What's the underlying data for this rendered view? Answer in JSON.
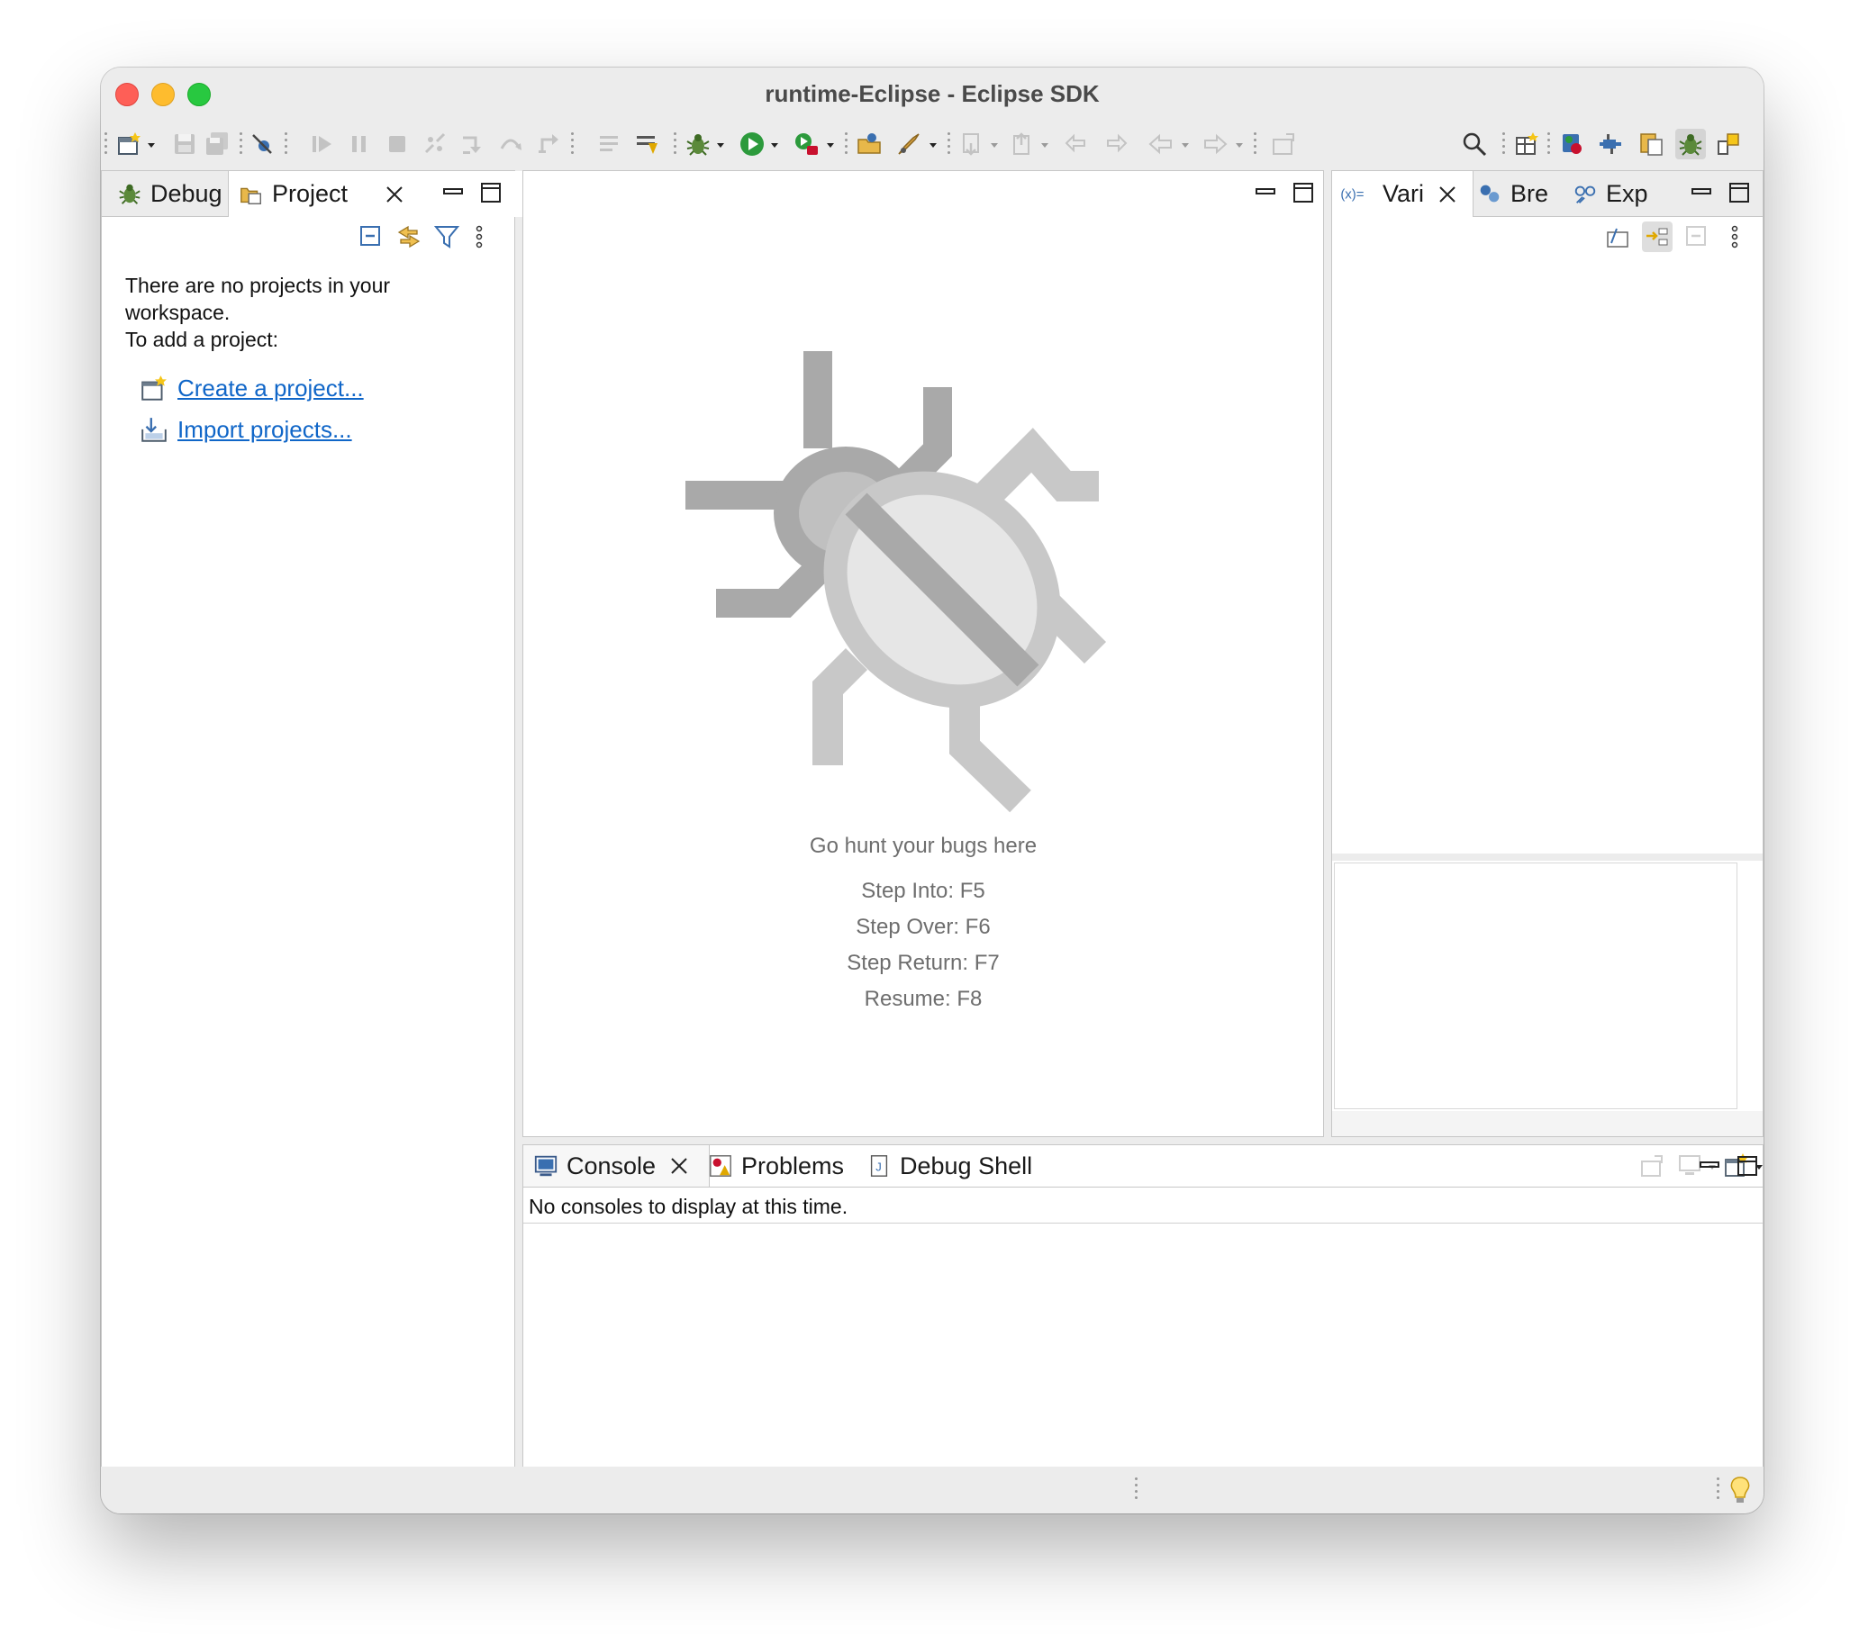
{
  "window": {
    "title": "runtime-Eclipse - Eclipse SDK"
  },
  "toolbar": {
    "icons": [
      "new-wizard-icon",
      "save-icon",
      "save-all-icon",
      "skip-breakpoints-icon",
      "resume-icon",
      "suspend-icon",
      "terminate-icon",
      "disconnect-icon",
      "step-into-icon",
      "step-over-icon",
      "step-return-icon",
      "drop-to-frame-icon",
      "use-step-filters-icon",
      "debug-icon",
      "run-icon",
      "external-tools-icon",
      "open-type-icon",
      "open-task-icon",
      "next-annotation-icon",
      "previous-annotation-icon",
      "last-edit-icon",
      "back-icon",
      "forward-icon",
      "pin-editor-icon",
      "search-icon",
      "open-perspective-icon",
      "java-perspective-icon",
      "plugin-perspective-icon",
      "resource-perspective-icon",
      "debug-perspective-icon",
      "git-perspective-icon"
    ]
  },
  "left_panel": {
    "tabs": [
      {
        "label": "Debug",
        "icon": "bug-icon"
      },
      {
        "label": "Project",
        "icon": "project-explorer-icon"
      }
    ],
    "empty_line1": "There are no projects in your workspace.",
    "empty_line2": "To add a project:",
    "create_link": "Create a project...",
    "import_link": "Import projects..."
  },
  "editor": {
    "headline": "Go hunt your bugs here",
    "shortcuts": [
      "Step Into: F5",
      "Step Over: F6",
      "Step Return: F7",
      "Resume: F8"
    ]
  },
  "right_panel": {
    "tabs": [
      {
        "label": "Vari",
        "icon": "variables-icon"
      },
      {
        "label": "Bre",
        "icon": "breakpoints-icon"
      },
      {
        "label": "Exp",
        "icon": "expressions-icon"
      }
    ]
  },
  "bottom_panel": {
    "tabs": [
      {
        "label": "Console",
        "icon": "console-icon"
      },
      {
        "label": "Problems",
        "icon": "problems-icon"
      },
      {
        "label": "Debug Shell",
        "icon": "debug-shell-icon"
      }
    ],
    "message": "No consoles to display at this time."
  },
  "colors": {
    "accent": "#1066c8",
    "bug_gray": "#c8c8c8",
    "panel_border": "#c7c7c7"
  }
}
